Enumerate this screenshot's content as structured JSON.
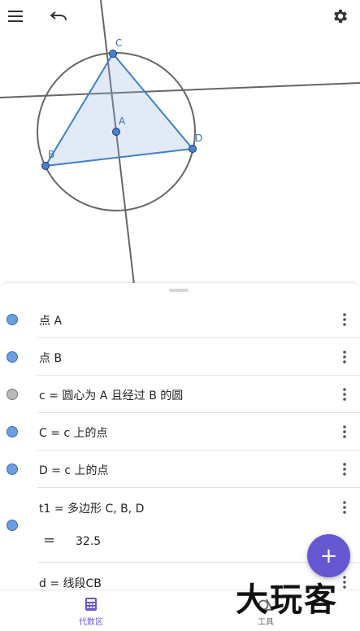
{
  "toolbar": {
    "menu_icon": "hamburger-menu-icon",
    "undo_icon": "undo-icon",
    "settings_icon": "gear-icon"
  },
  "geometry": {
    "points": [
      {
        "name": "A",
        "label": "A"
      },
      {
        "name": "B",
        "label": "B"
      },
      {
        "name": "C",
        "label": "C"
      },
      {
        "name": "D",
        "label": "D"
      }
    ]
  },
  "algebra": {
    "items": [
      {
        "label": "点 A",
        "color": "#6a9ee0"
      },
      {
        "label": "点 B",
        "color": "#6a9ee0"
      },
      {
        "label": "c = 圆心为 A 且经过 B 的圆",
        "color": "#b9b9b9"
      },
      {
        "label": "C = c 上的点",
        "color": "#6a9ee0"
      },
      {
        "label": "D = c 上的点",
        "color": "#6a9ee0"
      },
      {
        "label": "t1 = 多边形 C, B, D",
        "color": "#6a9ee0",
        "result_symbol": "=",
        "result": "32.5"
      },
      {
        "label": "d = 线段CB",
        "color": "#6a9ee0"
      }
    ]
  },
  "fab": {
    "label": "+"
  },
  "bottom_nav": {
    "algebra_label": "代数区",
    "tools_label": "工具",
    "active_color": "#6557d2"
  },
  "watermark": "大玩客"
}
